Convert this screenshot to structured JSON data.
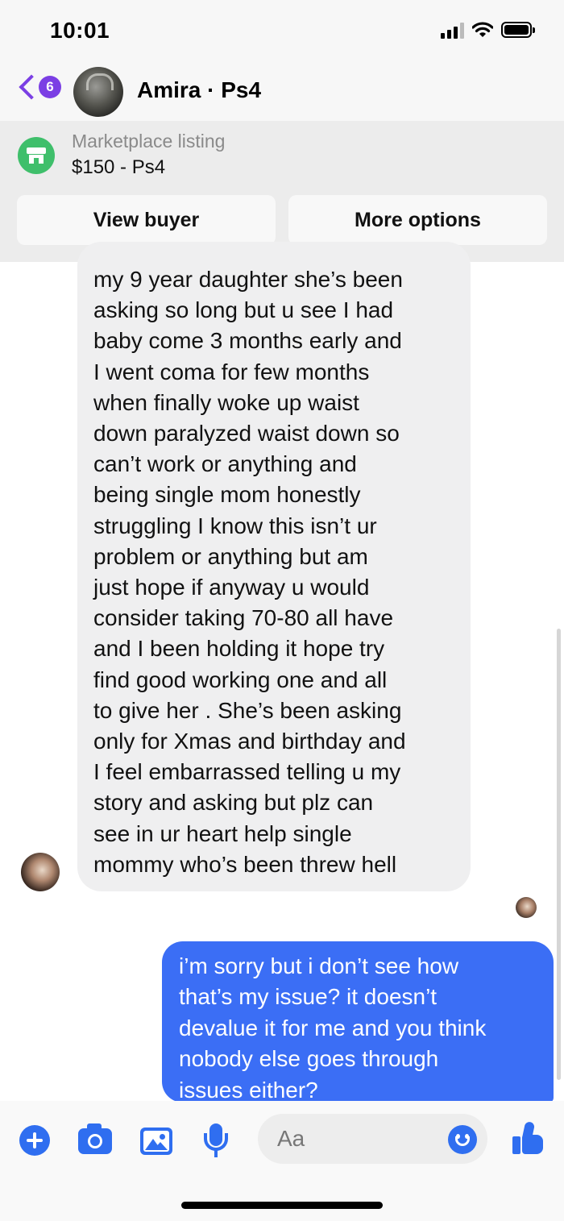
{
  "status_bar": {
    "time": "10:01",
    "battery_level": 1.0
  },
  "header": {
    "unread_count": "6",
    "contact_name": "Amira · Ps4",
    "accent_color": "#7b3fe4"
  },
  "marketplace": {
    "label": "Marketplace listing",
    "listing_title": "$150 - Ps4",
    "icon": "marketplace-store-icon",
    "buttons": {
      "view_buyer": "View buyer",
      "more_options": "More options"
    }
  },
  "messages": [
    {
      "direction": "incoming",
      "lines": [
        "my 9 year daughter she’s been",
        "asking so long but u see I had",
        "baby come 3 months early and",
        "I went coma for few months",
        "when finally woke up waist",
        "down paralyzed waist down so",
        "can’t work or anything and",
        "being single mom honestly",
        "struggling I know this isn’t ur",
        "problem or anything but am",
        "just hope if anyway u would",
        "consider taking 70-80 all have",
        "and I been holding it hope try",
        "find good working one and all",
        "to give her . She’s been asking",
        "only for Xmas and birthday and",
        "I feel embarrassed telling u my",
        "story and asking but plz can",
        "see in ur heart help single",
        "mommy who’s been threw hell"
      ]
    },
    {
      "direction": "outgoing",
      "lines": [
        "i’m sorry but i don’t see how",
        "that’s my issue? it doesn’t",
        "devalue it for me and you think",
        "nobody else goes through",
        "issues either?"
      ]
    }
  ],
  "composer": {
    "placeholder": "Aa",
    "accent_color": "#2f6ef0",
    "icons": [
      "plus-icon",
      "camera-icon",
      "photo-icon",
      "microphone-icon",
      "emoji-icon",
      "thumbs-up-icon"
    ]
  },
  "colors": {
    "incoming_bubble": "#efeff0",
    "outgoing_bubble": "#3b6ef5",
    "marketplace_green": "#3fbf6b"
  }
}
